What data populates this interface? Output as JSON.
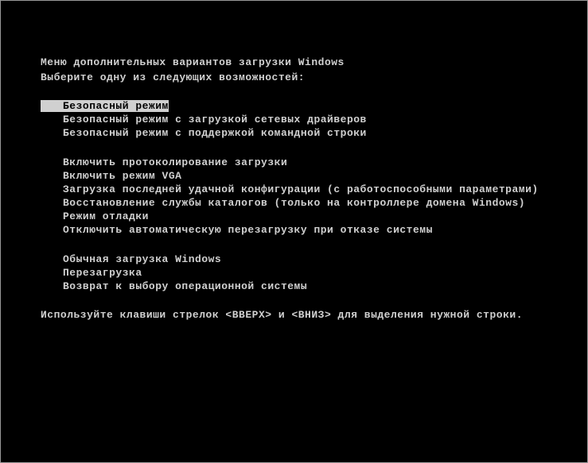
{
  "header": {
    "title": "Меню дополнительных вариантов загрузки Windows",
    "subtitle": "Выберите одну из следующих возможностей:"
  },
  "menu": {
    "groups": [
      {
        "items": [
          {
            "label": "Безопасный режим",
            "selected": true
          },
          {
            "label": "Безопасный режим с загрузкой сетевых драйверов",
            "selected": false
          },
          {
            "label": "Безопасный режим с поддержкой командной строки",
            "selected": false
          }
        ]
      },
      {
        "items": [
          {
            "label": "Включить протоколирование загрузки",
            "selected": false
          },
          {
            "label": "Включить режим VGA",
            "selected": false
          },
          {
            "label": "Загрузка последней удачной конфигурации (с работоспособными параметрами)",
            "selected": false
          },
          {
            "label": "Восстановление службы каталогов (только на контроллере домена Windows)",
            "selected": false
          },
          {
            "label": "Режим отладки",
            "selected": false
          },
          {
            "label": "Отключить автоматическую перезагрузку при отказе системы",
            "selected": false
          }
        ]
      },
      {
        "items": [
          {
            "label": "Обычная загрузка Windows",
            "selected": false
          },
          {
            "label": "Перезагрузка",
            "selected": false
          },
          {
            "label": "Возврат к выбору операционной системы",
            "selected": false
          }
        ]
      }
    ]
  },
  "footer": {
    "hint": "Используйте клавиши стрелок <ВВЕРХ> и <ВНИЗ> для выделения нужной строки."
  }
}
